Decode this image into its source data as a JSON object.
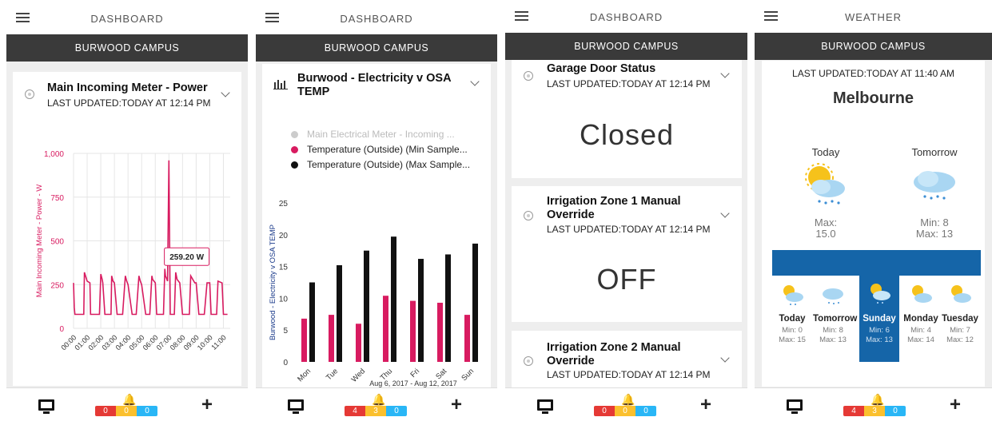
{
  "app": {
    "campus": "BURWOOD CAMPUS"
  },
  "screens": [
    {
      "header_title": "DASHBOARD",
      "card": {
        "title": "Main Incoming Meter - Power",
        "updated": "LAST UPDATED:TODAY AT 12:14 PM"
      },
      "badges": [
        "0",
        "0",
        "0"
      ]
    },
    {
      "header_title": "DASHBOARD",
      "card": {
        "title": "Burwood - Electricity v OSA TEMP",
        "legend": [
          "Main Electrical Meter - Incoming ...",
          "Temperature (Outside) (Min Sample...",
          "Temperature (Outside) (Max Sample..."
        ]
      },
      "badges": [
        "4",
        "3",
        "0"
      ]
    },
    {
      "header_title": "DASHBOARD",
      "cards": [
        {
          "title": "Garage Door Status",
          "updated": "LAST UPDATED:TODAY AT 12:14 PM",
          "state": "Closed"
        },
        {
          "title": "Irrigation Zone 1 Manual Override",
          "updated": "LAST UPDATED:TODAY AT 12:14 PM",
          "state": "OFF"
        },
        {
          "title": "Irrigation Zone 2 Manual Override",
          "updated": "LAST UPDATED:TODAY AT 12:14 PM"
        }
      ],
      "badges": [
        "0",
        "0",
        "0"
      ]
    },
    {
      "header_title": "WEATHER",
      "weather": {
        "updated": "LAST UPDATED:TODAY AT 11:40 AM",
        "city": "Melbourne",
        "today": {
          "label": "Today",
          "line1": "Max:",
          "line2": "15.0"
        },
        "tomorrow": {
          "label": "Tomorrow",
          "line1": "Min: 8",
          "line2": "Max: 13"
        },
        "forecast": [
          {
            "day": "Today",
            "min": "Min: 0",
            "max": "Max: 15"
          },
          {
            "day": "Tomorrow",
            "min": "Min: 8",
            "max": "Max: 13"
          },
          {
            "day": "Sunday",
            "min": "Min: 6",
            "max": "Max: 13"
          },
          {
            "day": "Monday",
            "min": "Min: 4",
            "max": "Max: 14"
          },
          {
            "day": "Tuesday",
            "min": "Min: 7",
            "max": "Max: 12"
          }
        ]
      },
      "badges": [
        "4",
        "3",
        "0"
      ]
    }
  ],
  "colors": {
    "series_pink": "#d81b60",
    "series_black": "#111111",
    "series_grey": "#cccccc",
    "forecast_selected": "#1565a8"
  },
  "chart_data": [
    {
      "type": "line",
      "ylabel": "Main Incoming Meter - Power - W",
      "x_ticks": [
        "00:00",
        "01:00",
        "02:00",
        "03:00",
        "04:00",
        "05:00",
        "06:00",
        "07:00",
        "08:00",
        "09:00",
        "10:00",
        "11:00"
      ],
      "y_ticks": [
        "0",
        "250",
        "500",
        "750",
        "1,000"
      ],
      "ylim": [
        0,
        1000
      ],
      "tooltip": {
        "value": "259.20",
        "unit": "W"
      },
      "series": [
        {
          "x": [
            0,
            0.05,
            0.1,
            0.4,
            0.6,
            0.75,
            0.8,
            1.0,
            1.2,
            1.25,
            1.35,
            1.4,
            1.6,
            1.9,
            2.0,
            2.1,
            2.15,
            2.3,
            2.4,
            2.6,
            2.75,
            2.8,
            2.9,
            3.0,
            3.2,
            3.5,
            3.6,
            3.8,
            3.9,
            4.0,
            4.3,
            4.5,
            4.6,
            4.8,
            4.9,
            5.0,
            5.3,
            5.5,
            5.6,
            5.75,
            5.8,
            5.9,
            6.0,
            6.1,
            6.4,
            6.6,
            6.7,
            6.75,
            6.8,
            6.9,
            7.0,
            7.1,
            7.3,
            7.4,
            7.5,
            7.6,
            7.8,
            8.0,
            8.1,
            8.3,
            8.5,
            8.6,
            8.9,
            9.0,
            9.2,
            9.5,
            9.6,
            9.8,
            10.0,
            10.1,
            10.3,
            10.5,
            10.6,
            10.9,
            11.0,
            11.3
          ],
          "y": [
            260,
            120,
            80,
            80,
            80,
            80,
            320,
            270,
            260,
            80,
            80,
            80,
            80,
            80,
            310,
            280,
            260,
            80,
            80,
            80,
            80,
            300,
            270,
            260,
            80,
            80,
            80,
            300,
            270,
            250,
            80,
            80,
            80,
            300,
            270,
            250,
            80,
            80,
            80,
            300,
            280,
            270,
            260,
            80,
            80,
            80,
            340,
            300,
            290,
            270,
            960,
            80,
            80,
            80,
            320,
            280,
            260,
            80,
            80,
            80,
            80,
            300,
            260,
            260,
            80,
            80,
            80,
            260,
            260,
            80,
            80,
            80,
            270,
            260,
            80,
            80
          ]
        }
      ]
    },
    {
      "type": "bar",
      "ylabel": "Burwood - Electricity v OSA TEMP",
      "xlabel": "Aug 6, 2017 - Aug 12, 2017",
      "categories": [
        "Mon",
        "Tue",
        "Wed",
        "Thu",
        "Fri",
        "Sat",
        "Sun"
      ],
      "y_ticks": [
        "0",
        "5",
        "10",
        "15",
        "20",
        "25"
      ],
      "ylim": [
        0,
        25
      ],
      "series": [
        {
          "name": "Temperature (Outside) (Min Sample...",
          "values": [
            6.8,
            7.4,
            6.0,
            10.4,
            9.6,
            9.3,
            7.4
          ]
        },
        {
          "name": "Temperature (Outside) (Max Sample...",
          "values": [
            12.5,
            15.2,
            17.5,
            19.7,
            16.2,
            16.9,
            18.6
          ]
        }
      ]
    }
  ]
}
